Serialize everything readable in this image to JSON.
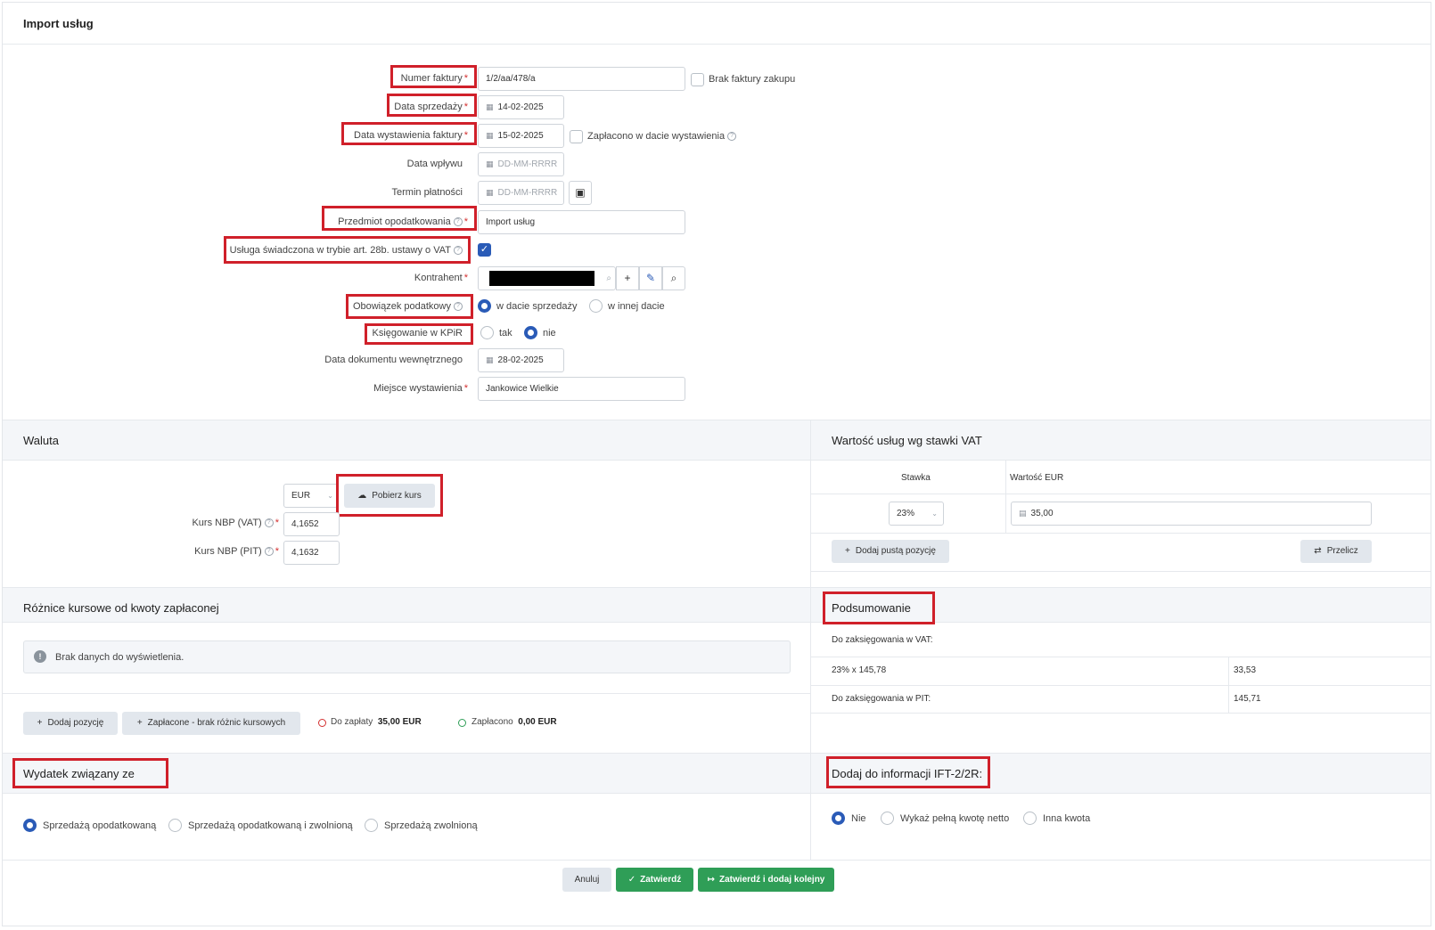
{
  "page_title": "Import usług",
  "form": {
    "numer_faktury": {
      "label": "Numer faktury",
      "value": "1/2/aa/478/a"
    },
    "brak_faktury": {
      "label": "Brak faktury zakupu"
    },
    "data_sprzedazy": {
      "label": "Data sprzedaży",
      "value": "14-02-2025"
    },
    "data_wystawienia": {
      "label": "Data wystawienia faktury",
      "value": "15-02-2025"
    },
    "zaplacono_w_dacie": {
      "label": "Zapłacono w dacie wystawienia"
    },
    "data_wplywu": {
      "label": "Data wpływu",
      "placeholder": "DD-MM-RRRR"
    },
    "termin_platnosci": {
      "label": "Termin płatności",
      "placeholder": "DD-MM-RRRR"
    },
    "przedmiot_opodatkowania": {
      "label": "Przedmiot opodatkowania",
      "value": "Import usług"
    },
    "usluga_28b": {
      "label": "Usługa świadczona w trybie art. 28b. ustawy o VAT",
      "checked": true
    },
    "kontrahent": {
      "label": "Kontrahent"
    },
    "obowiazek_podatkowy": {
      "label": "Obowiązek podatkowy",
      "opt1": "w dacie sprzedaży",
      "opt2": "w innej dacie",
      "selected": "w dacie sprzedaży"
    },
    "ksiegowanie_kpir": {
      "label": "Księgowanie w KPiR",
      "opt1": "tak",
      "opt2": "nie",
      "selected": "nie"
    },
    "data_dokumentu_wewn": {
      "label": "Data dokumentu wewnętrznego",
      "value": "28-02-2025"
    },
    "miejsce_wystawienia": {
      "label": "Miejsce wystawienia",
      "value": "Jankowice Wielkie"
    }
  },
  "waluta": {
    "title": "Waluta",
    "currency": "EUR",
    "pobierz_kurs": "Pobierz kurs",
    "kurs_vat_label": "Kurs NBP (VAT)",
    "kurs_vat": "4,1652",
    "kurs_pit_label": "Kurs NBP (PIT)",
    "kurs_pit": "4,1632"
  },
  "wartosc_uslug": {
    "title": "Wartość usług wg stawki VAT",
    "col_stawka": "Stawka",
    "col_wartosc": "Wartość EUR",
    "stawka": "23%",
    "wartosc": "35,00",
    "dodaj_pusta": "Dodaj pustą pozycję",
    "przelicz": "Przelicz"
  },
  "roznice": {
    "title": "Różnice kursowe od kwoty zapłaconej",
    "empty": "Brak danych do wyświetlenia.",
    "dodaj_pozycje": "Dodaj pozycję",
    "zaplacone_brak": "Zapłacone - brak różnic kursowych",
    "do_zaplaty_label": "Do zapłaty",
    "do_zaplaty_value": "35,00 EUR",
    "zaplacono_label": "Zapłacono",
    "zaplacono_value": "0,00 EUR"
  },
  "podsumowanie": {
    "title": "Podsumowanie",
    "vat_label": "Do zaksięgowania w VAT:",
    "vat_row_label": "23% x 145,78",
    "vat_row_value": "33,53",
    "pit_label": "Do zaksięgowania w PIT:",
    "pit_value": "145,71"
  },
  "wydatek": {
    "title": "Wydatek związany ze",
    "opt1": "Sprzedażą opodatkowaną",
    "opt2": "Sprzedażą opodatkowaną i zwolnioną",
    "opt3": "Sprzedażą zwolnioną",
    "selected": "Sprzedażą opodatkowaną"
  },
  "ift": {
    "title": "Dodaj do informacji IFT-2/2R:",
    "opt1": "Nie",
    "opt2": "Wykaż pełną kwotę netto",
    "opt3": "Inna kwota",
    "selected": "Nie"
  },
  "footer": {
    "anuluj": "Anuluj",
    "zatwierdz": "Zatwierdź",
    "zatwierdz_dodaj": "Zatwierdź i dodaj kolejny"
  },
  "colors": {
    "accent": "#2a5bb7",
    "highlight": "#d0202a",
    "success": "#2f9e57",
    "danger": "#d32f2f"
  }
}
